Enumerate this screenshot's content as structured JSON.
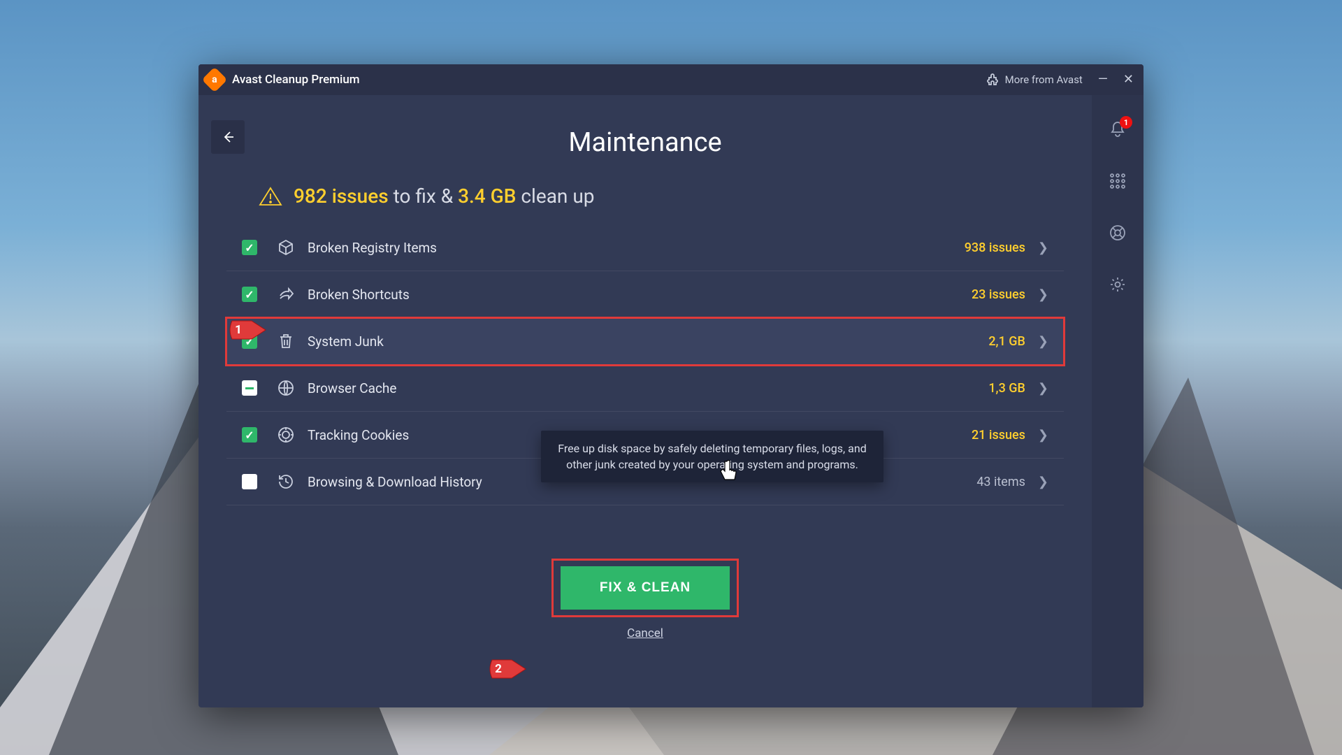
{
  "titlebar": {
    "app_name": "Avast Cleanup Premium",
    "more_label": "More from Avast"
  },
  "sidebar": {
    "notification_badge": "1"
  },
  "page": {
    "title": "Maintenance",
    "summary_issues": "982 issues",
    "summary_mid": " to fix & ",
    "summary_size": "3.4 GB",
    "summary_tail": " clean up"
  },
  "rows": [
    {
      "id": "registry",
      "label": "Broken Registry Items",
      "count": "938 issues",
      "hl": true,
      "chk": "checked",
      "icon": "cube-icon"
    },
    {
      "id": "shortcuts",
      "label": "Broken Shortcuts",
      "count": "23 issues",
      "hl": true,
      "chk": "checked",
      "icon": "share-icon"
    },
    {
      "id": "sysjunk",
      "label": "System Junk",
      "count": "2,1 GB",
      "hl": true,
      "chk": "checked",
      "icon": "trash-icon",
      "highlight": true
    },
    {
      "id": "cache",
      "label": "Browser Cache",
      "count": "1,3 GB",
      "hl": true,
      "chk": "partial",
      "icon": "globe-icon"
    },
    {
      "id": "cookies",
      "label": "Tracking Cookies",
      "count": "21 issues",
      "hl": true,
      "chk": "checked",
      "icon": "target-icon"
    },
    {
      "id": "history",
      "label": "Browsing & Download History",
      "count": "43 items",
      "hl": false,
      "chk": "empty",
      "icon": "history-icon"
    }
  ],
  "tooltip": "Free up disk space by safely deleting temporary files, logs, and other junk created by your operating system and programs.",
  "actions": {
    "fix": "FIX & CLEAN",
    "cancel": "Cancel"
  },
  "annotations": {
    "marker1": "1",
    "marker2": "2"
  }
}
